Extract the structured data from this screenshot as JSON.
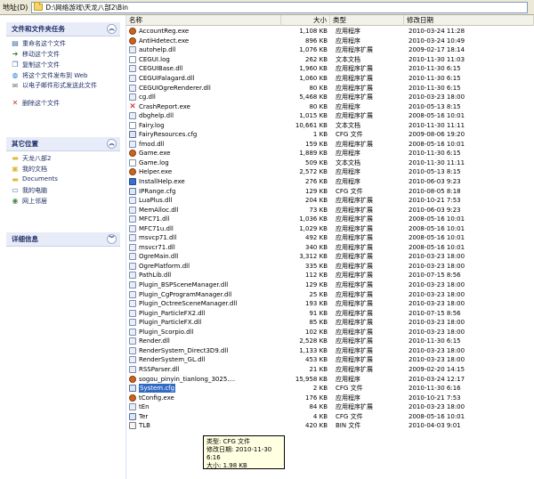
{
  "address": {
    "label": "地址(D)",
    "path": "D:\\网络游戏\\天龙八部2\\Bin"
  },
  "task_pane": {
    "file_tasks": {
      "title": "文件和文件夹任务",
      "items": [
        {
          "label": "重命名这个文件",
          "icon": "rename-icon"
        },
        {
          "label": "移动这个文件",
          "icon": "move-icon"
        },
        {
          "label": "复制这个文件",
          "icon": "copy-icon"
        },
        {
          "label": "将这个文件发布到 Web",
          "icon": "publish-web-icon"
        },
        {
          "label": "以电子邮件形式发送此文件",
          "icon": "email-icon"
        },
        {
          "label": "删除这个文件",
          "icon": "delete-icon"
        }
      ]
    },
    "other_places": {
      "title": "其它位置",
      "items": [
        {
          "label": "天龙八部2",
          "icon": "folder-icon"
        },
        {
          "label": "我的文档",
          "icon": "my-documents-icon"
        },
        {
          "label": "Documents",
          "icon": "folder-icon"
        },
        {
          "label": "我的电脑",
          "icon": "my-computer-icon"
        },
        {
          "label": "网上邻居",
          "icon": "network-places-icon"
        }
      ]
    },
    "details": {
      "title": "详细信息"
    }
  },
  "columns": {
    "name": "名称",
    "size": "大小",
    "type": "类型",
    "date": "修改日期"
  },
  "files": [
    {
      "name": "AccountReg.exe",
      "size": "1,108 KB",
      "type": "应用程序",
      "date": "2010-03-24 11:28",
      "icon": "exe"
    },
    {
      "name": "AntiHdetect.exe",
      "size": "896 KB",
      "type": "应用程序",
      "date": "2010-03-24 10:49",
      "icon": "exe"
    },
    {
      "name": "autohelp.dll",
      "size": "1,076 KB",
      "type": "应用程序扩展",
      "date": "2009-02-17 18:14",
      "icon": "dll"
    },
    {
      "name": "CEGUI.log",
      "size": "262 KB",
      "type": "文本文档",
      "date": "2010-11-30 11:03",
      "icon": "txt"
    },
    {
      "name": "CEGUIBase.dll",
      "size": "1,960 KB",
      "type": "应用程序扩展",
      "date": "2010-11-30 6:15",
      "icon": "dll"
    },
    {
      "name": "CEGUIFalagard.dll",
      "size": "1,060 KB",
      "type": "应用程序扩展",
      "date": "2010-11-30 6:15",
      "icon": "dll"
    },
    {
      "name": "CEGUIOgreRenderer.dll",
      "size": "80 KB",
      "type": "应用程序扩展",
      "date": "2010-11-30 6:15",
      "icon": "dll"
    },
    {
      "name": "cg.dll",
      "size": "5,468 KB",
      "type": "应用程序扩展",
      "date": "2010-03-23 18:00",
      "icon": "dll"
    },
    {
      "name": "CrashReport.exe",
      "size": "80 KB",
      "type": "应用程序",
      "date": "2010-05-13 8:15",
      "icon": "crash"
    },
    {
      "name": "dbghelp.dll",
      "size": "1,015 KB",
      "type": "应用程序扩展",
      "date": "2008-05-16 10:01",
      "icon": "dll"
    },
    {
      "name": "Fairy.log",
      "size": "10,661 KB",
      "type": "文本文档",
      "date": "2010-11-30 11:11",
      "icon": "txt"
    },
    {
      "name": "FairyResources.cfg",
      "size": "1 KB",
      "type": "CFG 文件",
      "date": "2009-08-06 19:20",
      "icon": "cfg"
    },
    {
      "name": "fmod.dll",
      "size": "159 KB",
      "type": "应用程序扩展",
      "date": "2008-05-16 10:01",
      "icon": "dll"
    },
    {
      "name": "Game.exe",
      "size": "1,889 KB",
      "type": "应用程序",
      "date": "2010-11-30 6:15",
      "icon": "exe"
    },
    {
      "name": "Game.log",
      "size": "509 KB",
      "type": "文本文档",
      "date": "2010-11-30 11:11",
      "icon": "txt"
    },
    {
      "name": "Helper.exe",
      "size": "2,572 KB",
      "type": "应用程序",
      "date": "2010-05-13 8:15",
      "icon": "exe"
    },
    {
      "name": "InstallHelp.exe",
      "size": "276 KB",
      "type": "应用程序",
      "date": "2010-06-03 9:23",
      "icon": "win"
    },
    {
      "name": "IPRange.cfg",
      "size": "129 KB",
      "type": "CFG 文件",
      "date": "2010-08-05 8:18",
      "icon": "cfg"
    },
    {
      "name": "LuaPlus.dll",
      "size": "204 KB",
      "type": "应用程序扩展",
      "date": "2010-10-21 7:53",
      "icon": "dll"
    },
    {
      "name": "MemAlloc.dll",
      "size": "73 KB",
      "type": "应用程序扩展",
      "date": "2010-06-03 9:23",
      "icon": "dll"
    },
    {
      "name": "MFC71.dll",
      "size": "1,036 KB",
      "type": "应用程序扩展",
      "date": "2008-05-16 10:01",
      "icon": "dll"
    },
    {
      "name": "MFC71u.dll",
      "size": "1,029 KB",
      "type": "应用程序扩展",
      "date": "2008-05-16 10:01",
      "icon": "dll"
    },
    {
      "name": "msvcp71.dll",
      "size": "492 KB",
      "type": "应用程序扩展",
      "date": "2008-05-16 10:01",
      "icon": "dll"
    },
    {
      "name": "msvcr71.dll",
      "size": "340 KB",
      "type": "应用程序扩展",
      "date": "2008-05-16 10:01",
      "icon": "dll"
    },
    {
      "name": "OgreMain.dll",
      "size": "3,312 KB",
      "type": "应用程序扩展",
      "date": "2010-03-23 18:00",
      "icon": "dll"
    },
    {
      "name": "OgrePlatform.dll",
      "size": "335 KB",
      "type": "应用程序扩展",
      "date": "2010-03-23 18:00",
      "icon": "dll"
    },
    {
      "name": "PathLib.dll",
      "size": "112 KB",
      "type": "应用程序扩展",
      "date": "2010-07-15 8:56",
      "icon": "dll"
    },
    {
      "name": "Plugin_BSPSceneManager.dll",
      "size": "129 KB",
      "type": "应用程序扩展",
      "date": "2010-03-23 18:00",
      "icon": "dll"
    },
    {
      "name": "Plugin_CgProgramManager.dll",
      "size": "25 KB",
      "type": "应用程序扩展",
      "date": "2010-03-23 18:00",
      "icon": "dll"
    },
    {
      "name": "Plugin_OctreeSceneManager.dll",
      "size": "193 KB",
      "type": "应用程序扩展",
      "date": "2010-03-23 18:00",
      "icon": "dll"
    },
    {
      "name": "Plugin_ParticleFX2.dll",
      "size": "91 KB",
      "type": "应用程序扩展",
      "date": "2010-07-15 8:56",
      "icon": "dll"
    },
    {
      "name": "Plugin_ParticleFX.dll",
      "size": "85 KB",
      "type": "应用程序扩展",
      "date": "2010-03-23 18:00",
      "icon": "dll"
    },
    {
      "name": "Plugin_Scorpio.dll",
      "size": "102 KB",
      "type": "应用程序扩展",
      "date": "2010-03-23 18:00",
      "icon": "dll"
    },
    {
      "name": "Render.dll",
      "size": "2,528 KB",
      "type": "应用程序扩展",
      "date": "2010-11-30 6:15",
      "icon": "dll"
    },
    {
      "name": "RenderSystem_Direct3D9.dll",
      "size": "1,133 KB",
      "type": "应用程序扩展",
      "date": "2010-03-23 18:00",
      "icon": "dll"
    },
    {
      "name": "RenderSystem_GL.dll",
      "size": "453 KB",
      "type": "应用程序扩展",
      "date": "2010-03-23 18:00",
      "icon": "dll"
    },
    {
      "name": "RSSParser.dll",
      "size": "21 KB",
      "type": "应用程序扩展",
      "date": "2009-02-20 14:15",
      "icon": "dll"
    },
    {
      "name": "sogou_pinyin_tianlong_3025....",
      "size": "15,958 KB",
      "type": "应用程序",
      "date": "2010-03-24 12:17",
      "icon": "exe"
    },
    {
      "name": "System.cfg",
      "size": "2 KB",
      "type": "CFG 文件",
      "date": "2010-11-30 6:16",
      "icon": "cfg",
      "selected": true
    },
    {
      "name": "tConfig.exe",
      "size": "176 KB",
      "type": "应用程序",
      "date": "2010-10-21 7:53",
      "icon": "exe"
    },
    {
      "name": "tEn",
      "size": "84 KB",
      "type": "应用程序扩展",
      "date": "2010-03-23 18:00",
      "icon": "dll"
    },
    {
      "name": "Ter",
      "size": "4 KB",
      "type": "CFG 文件",
      "date": "2008-05-16 10:01",
      "icon": "cfg"
    },
    {
      "name": "TLB",
      "size": "420 KB",
      "type": "BIN 文件",
      "date": "2010-04-03 9:01",
      "icon": "bin"
    }
  ],
  "tooltip": {
    "type_line": "类型: CFG 文件",
    "date_line": "修改日期: 2010-11-30 6:16",
    "size_line": "大小: 1.98 KB"
  }
}
